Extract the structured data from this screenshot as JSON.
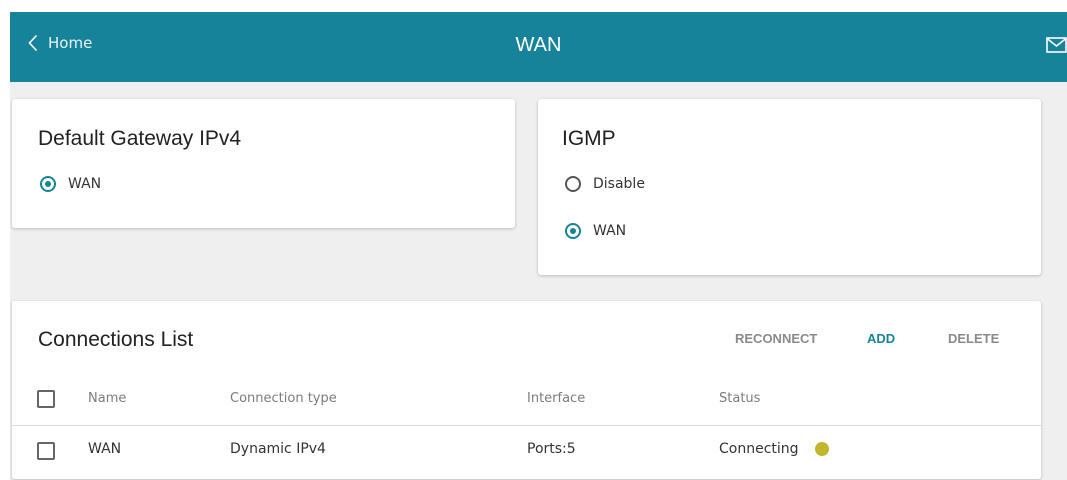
{
  "header": {
    "back_label": "Home",
    "title": "WAN",
    "back_icon": "chevron-left-icon",
    "mail_icon": "mail-icon"
  },
  "default_gateway": {
    "title": "Default Gateway IPv4",
    "options": [
      {
        "label": "WAN",
        "selected": true
      }
    ]
  },
  "igmp": {
    "title": "IGMP",
    "options": [
      {
        "label": "Disable",
        "selected": false
      },
      {
        "label": "WAN",
        "selected": true
      }
    ]
  },
  "connections": {
    "title": "Connections List",
    "actions": {
      "reconnect": "RECONNECT",
      "add": "ADD",
      "delete": "DELETE"
    },
    "columns": {
      "name": "Name",
      "type": "Connection type",
      "interface": "Interface",
      "status": "Status"
    },
    "rows": [
      {
        "name": "WAN",
        "type": "Dynamic IPv4",
        "interface": "Ports:5",
        "status": "Connecting",
        "status_color": "#c3b62d"
      }
    ]
  },
  "colors": {
    "accent": "#17839b",
    "background": "#efefef",
    "status_connecting": "#c3b62d"
  }
}
